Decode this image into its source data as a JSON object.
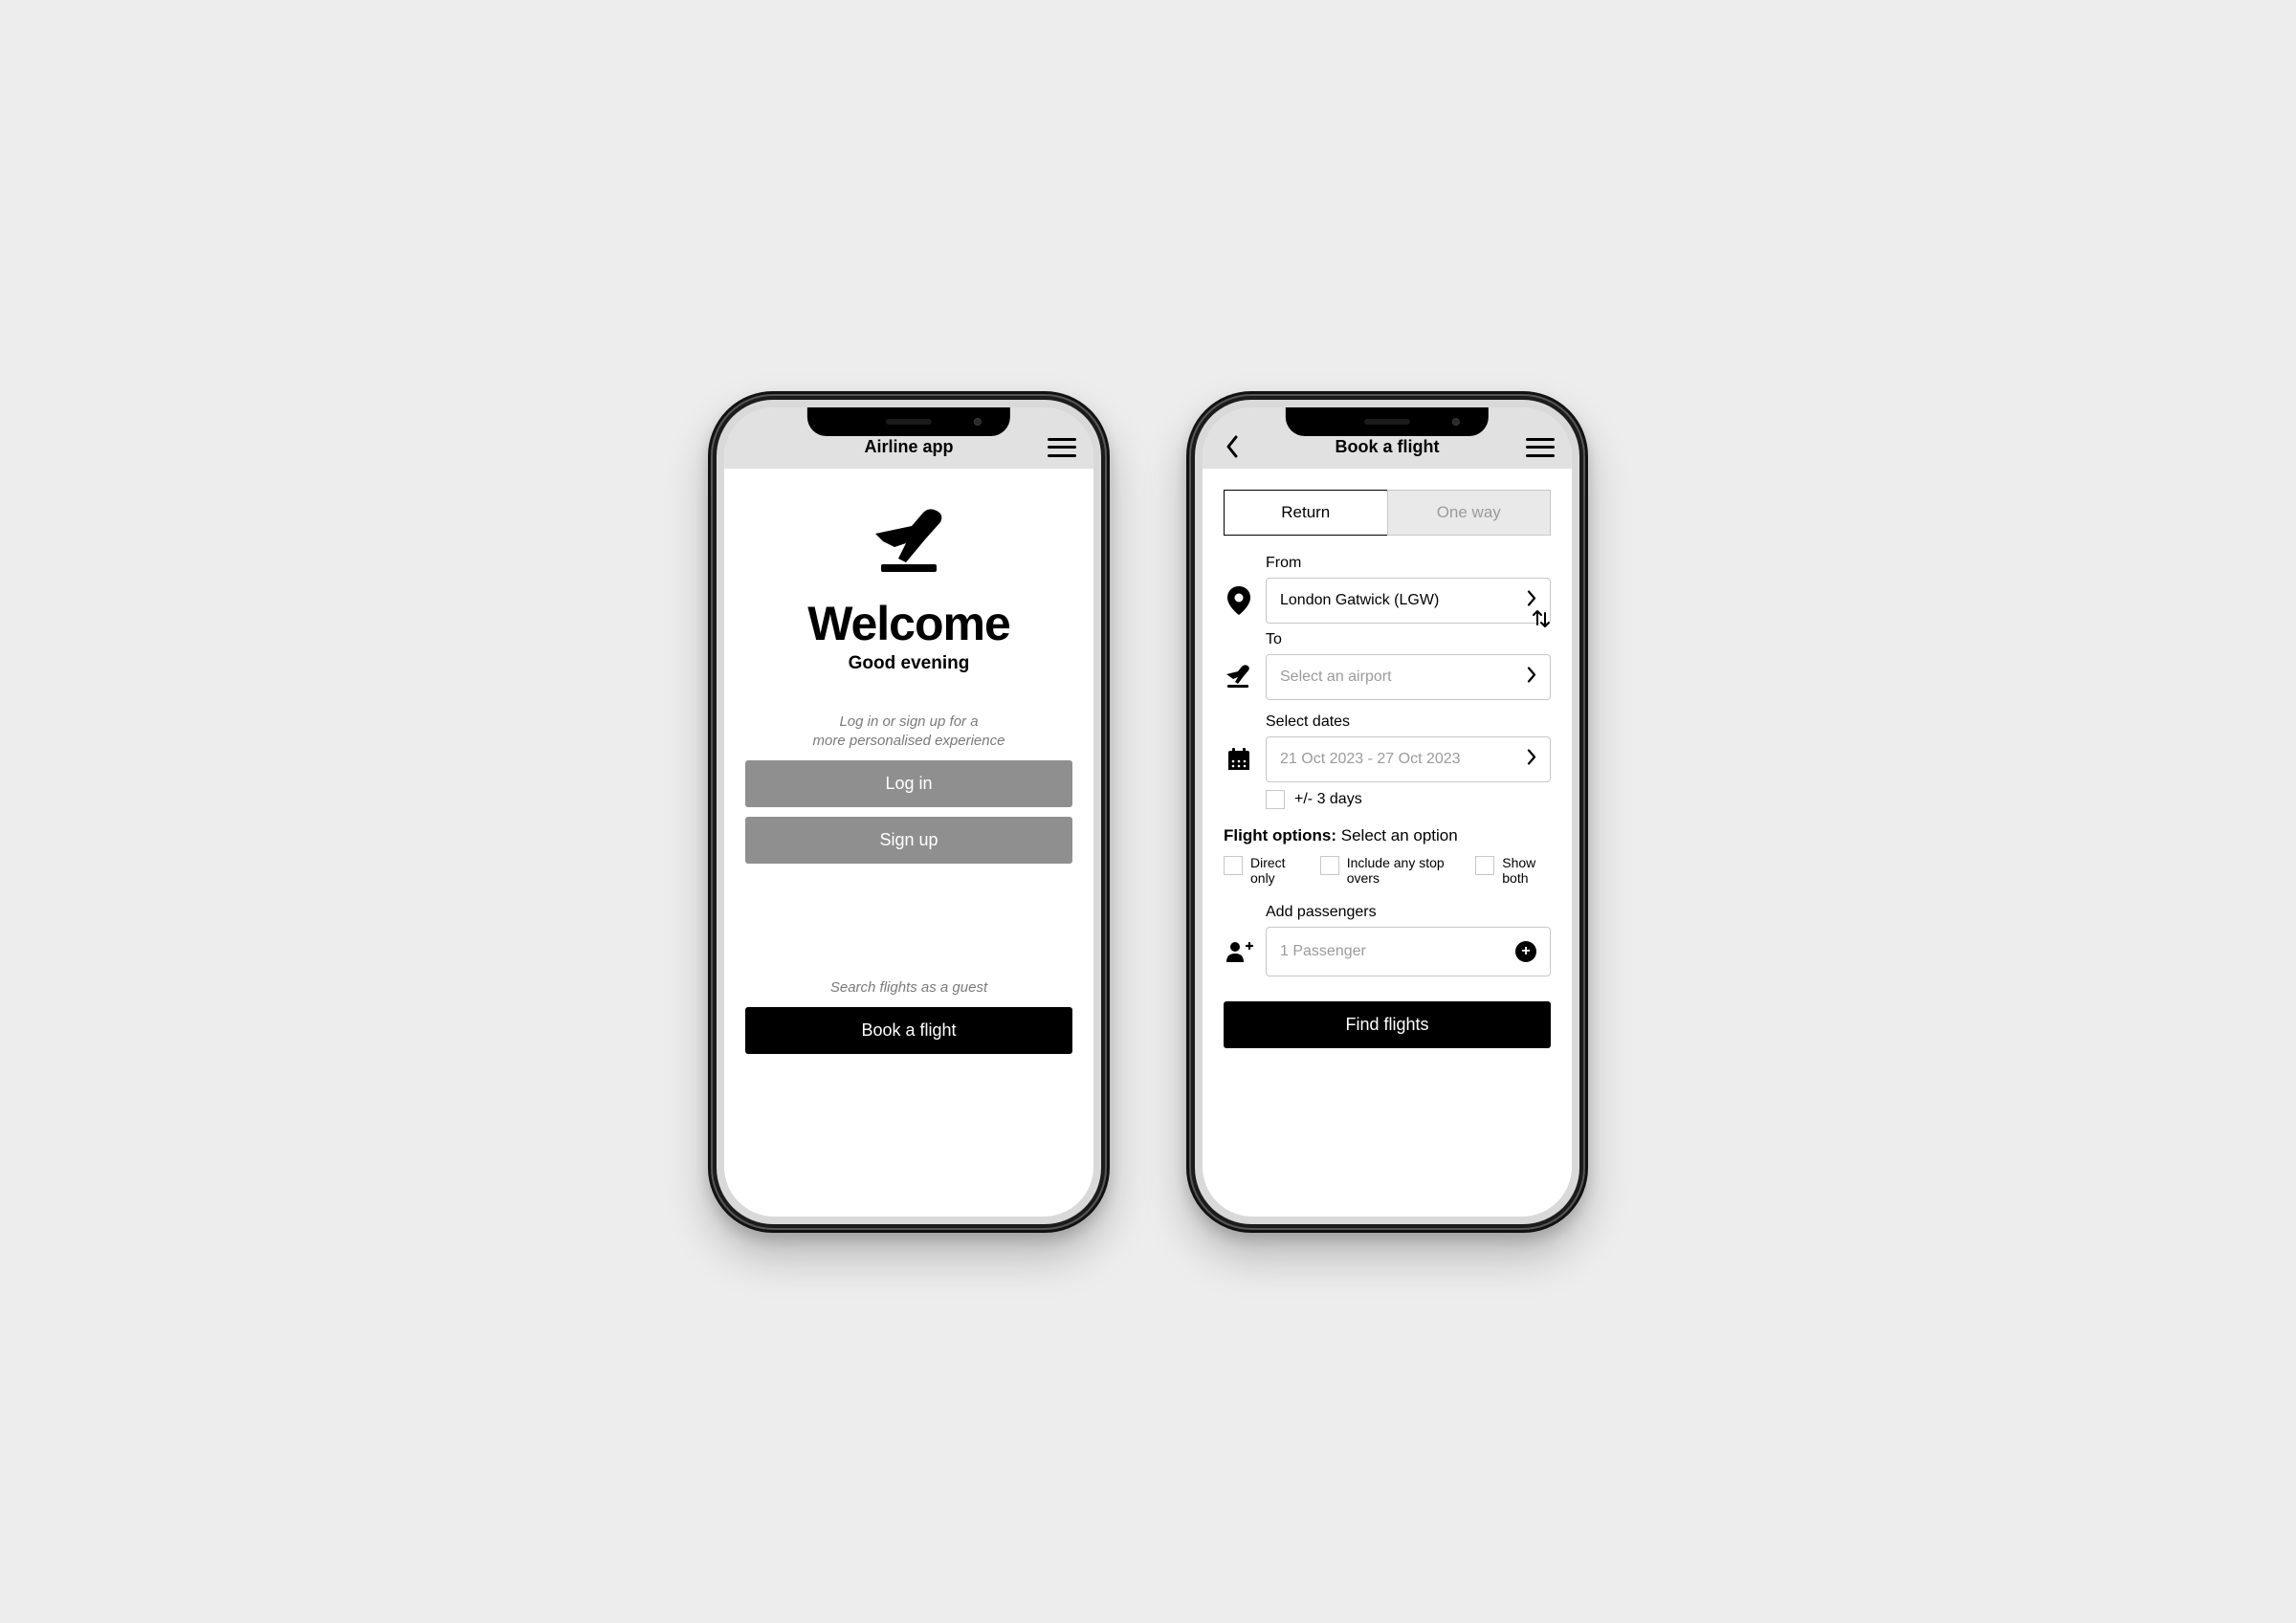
{
  "screen1": {
    "header_title": "Airline app",
    "welcome_heading": "Welcome",
    "welcome_sub": "Good evening",
    "hint_line1": "Log in or sign up for a",
    "hint_line2": "more personalised experience",
    "login_label": "Log in",
    "signup_label": "Sign up",
    "guest_hint": "Search flights as a guest",
    "book_label": "Book a flight"
  },
  "screen2": {
    "header_title": "Book a flight",
    "tab_return": "Return",
    "tab_oneway": "One way",
    "from_label": "From",
    "from_value": "London Gatwick (LGW)",
    "to_label": "To",
    "to_placeholder": "Select an airport",
    "dates_label": "Select dates",
    "dates_placeholder": "21 Oct 2023 - 27 Oct 2023",
    "flex_label": "+/- 3 days",
    "options_head": "Flight options:",
    "options_sub": "Select an option",
    "opt_direct": "Direct only",
    "opt_stops": "Include any stop overs",
    "opt_both": "Show both",
    "pass_label": "Add passengers",
    "pass_value": "1 Passenger",
    "find_label": "Find flights"
  }
}
